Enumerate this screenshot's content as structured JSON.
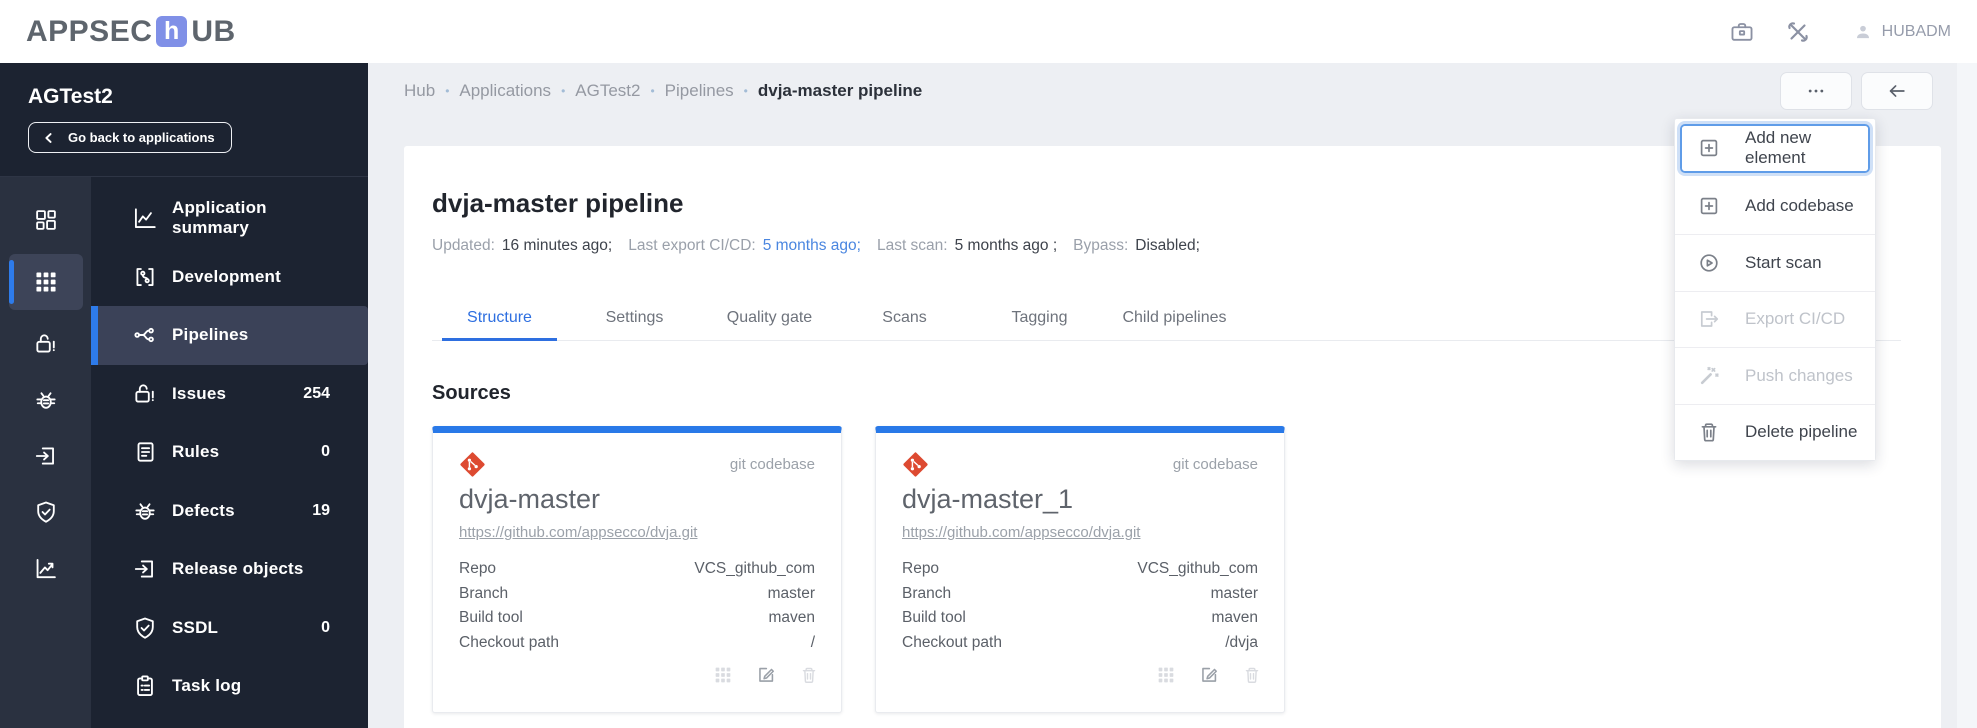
{
  "header": {
    "logo_pre": "APPSEC",
    "logo_h": "h",
    "logo_post": "UB",
    "user": "HUBADM"
  },
  "sidebar": {
    "app_name": "AGTest2",
    "back_button": "Go back to applications",
    "menu": [
      {
        "label": "Application summary"
      },
      {
        "label": "Development"
      },
      {
        "label": "Pipelines",
        "active": true
      },
      {
        "label": "Issues",
        "badge": "254"
      },
      {
        "label": "Rules",
        "badge": "0"
      },
      {
        "label": "Defects",
        "badge": "19"
      },
      {
        "label": "Release objects"
      },
      {
        "label": "SSDL",
        "badge": "0"
      },
      {
        "label": "Task log"
      }
    ]
  },
  "breadcrumb": {
    "items": [
      "Hub",
      "Applications",
      "AGTest2",
      "Pipelines"
    ],
    "separator": "•",
    "current": "dvja-master pipeline"
  },
  "page": {
    "title": "dvja-master pipeline",
    "meta": [
      {
        "label": "Updated:",
        "value": "16 minutes ago;"
      },
      {
        "label": "Last export CI/CD:",
        "value": "5 months ago;"
      },
      {
        "label": "Last scan:",
        "value": "5 months ago ;"
      },
      {
        "label": "Bypass:",
        "value": "Disabled;"
      }
    ],
    "tabs": [
      "Structure",
      "Settings",
      "Quality gate",
      "Scans",
      "Tagging",
      "Child pipelines"
    ],
    "active_tab": "Structure",
    "section_title": "Sources"
  },
  "cards": [
    {
      "type_label": "git codebase",
      "title": "dvja-master",
      "url": "https://github.com/appsecco/dvja.git",
      "fields": [
        {
          "label": "Repo",
          "value": "VCS_github_com"
        },
        {
          "label": "Branch",
          "value": "master"
        },
        {
          "label": "Build tool",
          "value": "maven"
        },
        {
          "label": "Checkout path",
          "value": "/"
        }
      ]
    },
    {
      "type_label": "git codebase",
      "title": "dvja-master_1",
      "url": "https://github.com/appsecco/dvja.git",
      "fields": [
        {
          "label": "Repo",
          "value": "VCS_github_com"
        },
        {
          "label": "Branch",
          "value": "master"
        },
        {
          "label": "Build tool",
          "value": "maven"
        },
        {
          "label": "Checkout path",
          "value": "/dvja"
        }
      ]
    }
  ],
  "context_menu": {
    "items": [
      {
        "label": "Add new element",
        "state": "focused"
      },
      {
        "label": "Add codebase"
      },
      {
        "label": "Start scan"
      },
      {
        "label": "Export CI/CD",
        "disabled": true
      },
      {
        "label": "Push changes",
        "disabled": true
      },
      {
        "label": "Delete pipeline"
      }
    ]
  },
  "colors": {
    "accent_blue": "#2e7bea",
    "active_tab_blue": "#2e6fe0",
    "card_top_bar": "#2979e8",
    "git_icon": "#dd4a31",
    "link_blue": "#4a86e0",
    "sidebar_bg": "#1c2331",
    "rail_bg": "#2a3140",
    "selected_row_bg": "#3b4258",
    "focus_ring": "#5f9ce8"
  }
}
